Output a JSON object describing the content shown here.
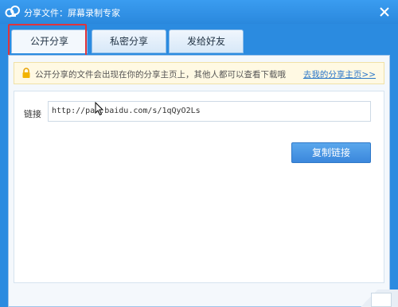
{
  "window": {
    "title": "分享文件：屏幕录制专家",
    "app_icon": "cloud-link-icon",
    "close_icon": "close-icon"
  },
  "tabs": [
    {
      "label": "公开分享",
      "active": true
    },
    {
      "label": "私密分享",
      "active": false
    },
    {
      "label": "发给好友",
      "active": false
    }
  ],
  "notice": {
    "icon": "lock-icon",
    "text": "公开分享的文件会出现在你的分享主页上，其他人都可以查看下载哦",
    "link": "去我的分享主页>>"
  },
  "share": {
    "link_label": "链接",
    "link_value": "http://pan.baidu.com/s/1qQyO2Ls",
    "copy_button": "复制链接"
  },
  "colors": {
    "title_bar": "#2b8be0",
    "accent_button": "#3b87dc",
    "highlight_box": "#e0343b",
    "notice_bg": "#fff9e3",
    "link": "#2a77c9"
  }
}
